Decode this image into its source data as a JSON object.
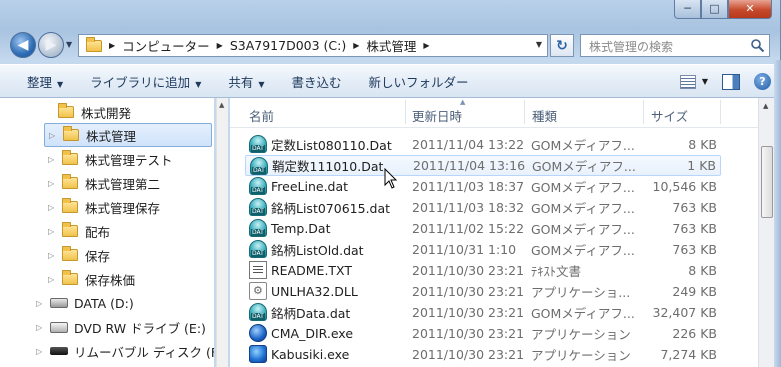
{
  "window": {
    "controls": {
      "minimize": "─",
      "maximize": "□",
      "close": "✕"
    }
  },
  "address": {
    "crumbs": [
      "コンピューター",
      "S3A7917D003 (C:)",
      "株式管理"
    ],
    "search_placeholder": "株式管理の検索"
  },
  "toolbar": {
    "organize": "整理",
    "add_to_library": "ライブラリに追加",
    "share": "共有",
    "burn": "書き込む",
    "new_folder": "新しいフォルダー"
  },
  "nav": {
    "items": [
      {
        "label": "株式開発",
        "type": "folder",
        "expander": ""
      },
      {
        "label": "株式管理",
        "type": "folder",
        "expander": "▷",
        "selected": true
      },
      {
        "label": "株式管理テスト",
        "type": "folder",
        "expander": "▷"
      },
      {
        "label": "株式管理第二",
        "type": "folder",
        "expander": "▷"
      },
      {
        "label": "株式管理保存",
        "type": "folder",
        "expander": "▷"
      },
      {
        "label": "配布",
        "type": "folder",
        "expander": "▷"
      },
      {
        "label": "保存",
        "type": "folder",
        "expander": "▷"
      },
      {
        "label": "保存株価",
        "type": "folder",
        "expander": "▷"
      },
      {
        "label": "DATA (D:)",
        "type": "drive",
        "expander": "▷"
      },
      {
        "label": "DVD RW ドライブ (E:)",
        "type": "dvd",
        "expander": "▷"
      },
      {
        "label": "リムーバブル ディスク (F",
        "type": "removable",
        "expander": "▷"
      }
    ]
  },
  "columns": {
    "name": "名前",
    "date": "更新日時",
    "type": "種類",
    "size": "サイズ"
  },
  "files": [
    {
      "name": "定数List080110.Dat",
      "date": "2011/11/04 13:22",
      "type": "GOMメディアフ...",
      "size": "8 KB",
      "icon": "dat-icon"
    },
    {
      "name": "鞘定数111010.Dat",
      "date": "2011/11/04 13:16",
      "type": "GOMメディアフ...",
      "size": "1 KB",
      "icon": "dat-icon",
      "hover": true
    },
    {
      "name": "FreeLine.dat",
      "date": "2011/11/03 18:37",
      "type": "GOMメディアフ...",
      "size": "10,546 KB",
      "icon": "dat-icon"
    },
    {
      "name": "銘柄List070615.dat",
      "date": "2011/11/03 18:32",
      "type": "GOMメディアフ...",
      "size": "763 KB",
      "icon": "dat-icon"
    },
    {
      "name": "Temp.Dat",
      "date": "2011/11/02 15:22",
      "type": "GOMメディアフ...",
      "size": "763 KB",
      "icon": "dat-icon"
    },
    {
      "name": "銘柄ListOld.dat",
      "date": "2011/10/31 1:10",
      "type": "GOMメディアフ...",
      "size": "763 KB",
      "icon": "dat-icon"
    },
    {
      "name": "README.TXT",
      "date": "2011/10/30 23:21",
      "type": "ﾃｷｽﾄ文書",
      "size": "8 KB",
      "icon": "text-file-icon"
    },
    {
      "name": "UNLHA32.DLL",
      "date": "2011/10/30 23:21",
      "type": "アプリケーショ...",
      "size": "249 KB",
      "icon": "dll-icon"
    },
    {
      "name": "銘柄Data.dat",
      "date": "2011/10/30 23:21",
      "type": "GOMメディアフ...",
      "size": "32,407 KB",
      "icon": "dat-icon"
    },
    {
      "name": "CMA_DIR.exe",
      "date": "2011/10/30 23:21",
      "type": "アプリケーション",
      "size": "226 KB",
      "icon": "exe-icon"
    },
    {
      "name": "Kabusiki.exe",
      "date": "2011/10/30 23:21",
      "type": "アプリケーション",
      "size": "7,274 KB",
      "icon": "exe-icon"
    }
  ]
}
